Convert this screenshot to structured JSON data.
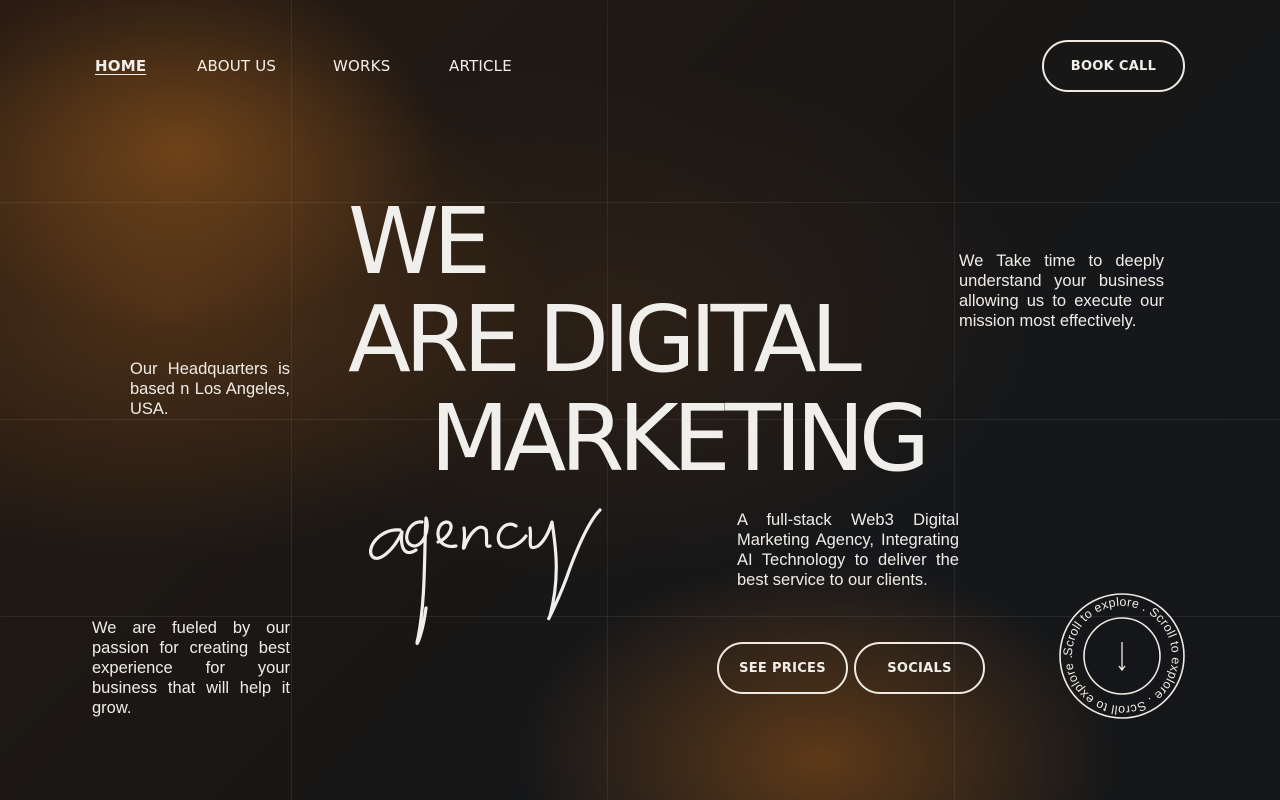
{
  "nav": {
    "items": [
      {
        "label": "HOME",
        "active": true
      },
      {
        "label": "ABOUT US",
        "active": false
      },
      {
        "label": "WORKS",
        "active": false
      },
      {
        "label": "ARTICLE",
        "active": false
      }
    ],
    "cta_label": "BOOK CALL"
  },
  "hero": {
    "line1": "WE",
    "line2": "ARE DIGITAL",
    "line3": "MARKETING",
    "script_word": "agency"
  },
  "text": {
    "headquarters": "Our Headquarters is based n Los Angeles, USA.",
    "passion": "We are fueled by our passion for creating best experience for your business that will help it grow.",
    "understand": "We Take time to deeply understand your business allowing us to execute our mission most effectively.",
    "fullstack": "A full-stack Web3 Digital Marketing Agency, Integrating AI Technology to deliver the best service to our clients."
  },
  "buttons": {
    "see_prices": "SEE PRICES",
    "socials": "SOCIALS"
  },
  "scroll": {
    "circle_text": "Scroll to explore . Scroll to explore . Scroll to explore .",
    "icon": "arrow-down-icon"
  },
  "colors": {
    "text": "#f2efea",
    "accent_brown": "#78481a",
    "background_dark": "#15171a"
  }
}
